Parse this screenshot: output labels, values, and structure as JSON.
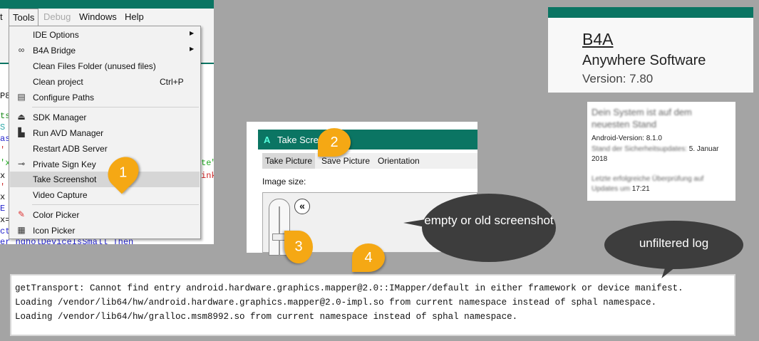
{
  "ide": {
    "menubar": {
      "partial": "t",
      "tools": "Tools",
      "debug": "Debug",
      "windows": "Windows",
      "help": "Help"
    },
    "code_fragments": [
      "P8",
      "ts",
      "S",
      "as",
      "'",
      "'x",
      "x",
      "'",
      "x",
      "E",
      "x=",
      "ct",
      "er  ngholDeviceIsSmall Then"
    ],
    "right_fragments": [
      "te\"",
      "ink"
    ],
    "tools_menu": [
      {
        "label": "IDE Options",
        "icon": "",
        "submenu": true
      },
      {
        "label": "B4A Bridge",
        "icon": "link-icon",
        "submenu": true
      },
      {
        "label": "Clean Files Folder (unused files)"
      },
      {
        "label": "Clean project",
        "shortcut": "Ctrl+P"
      },
      {
        "label": "Configure Paths",
        "icon": "paths-icon"
      },
      {
        "label": "SDK Manager",
        "icon": "sdk-icon"
      },
      {
        "label": "Run AVD Manager",
        "icon": "avd-icon"
      },
      {
        "label": "Restart ADB Server"
      },
      {
        "label": "Private Sign Key",
        "icon": "key-icon"
      },
      {
        "label": "Take Screenshot",
        "highlighted": true
      },
      {
        "label": "Video Capture"
      },
      {
        "label": "Color Picker",
        "icon": "color-picker-icon"
      },
      {
        "label": "Icon Picker",
        "icon": "icon-picker-icon"
      }
    ]
  },
  "screenshot_window": {
    "title": "Take Screens",
    "logo": "A",
    "menu": [
      "Take Picture",
      "Save Picture",
      "Orientation"
    ],
    "image_size_label": "Image size:",
    "collapse_glyph": "«"
  },
  "callouts": {
    "pins": [
      "1",
      "2",
      "3",
      "4"
    ],
    "bubble_screenshot": "empty or old screenshot",
    "bubble_log": "unfiltered log"
  },
  "about": {
    "product": "B4A",
    "company": "Anywhere Software",
    "version": "Version: 7.80"
  },
  "android": {
    "heading": "Dein System ist auf dem neuesten Stand",
    "version": "Android-Version: 8.1.0",
    "patch_label": "Stand der Sicherheitsupdates:",
    "patch_date": "5. Januar 2018",
    "last_check_label": "Letzte erfolgreiche Überprüfung auf Updates um",
    "last_check_time": "17:21"
  },
  "log": {
    "lines": [
      "getTransport: Cannot find entry android.hardware.graphics.mapper@2.0::IMapper/default in either framework or device manifest.",
      "Loading /vendor/lib64/hw/android.hardware.graphics.mapper@2.0-impl.so from current namespace instead of sphal namespace.",
      "Loading /vendor/lib64/hw/gralloc.msm8992.so from current namespace instead of sphal namespace."
    ]
  },
  "colors": {
    "teal": "#0b7563",
    "pin": "#f5a814",
    "bubble": "#3d3d3d",
    "background": "#a4a4a4"
  }
}
